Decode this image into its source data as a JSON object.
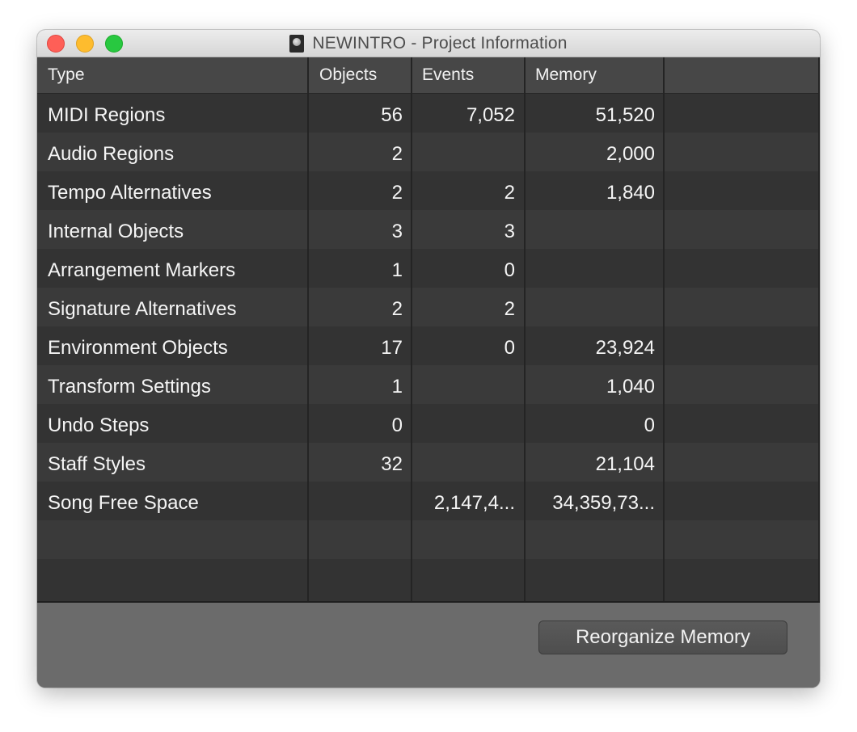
{
  "window": {
    "title": "NEWINTRO - Project Information",
    "icon": "logic-project-document-icon"
  },
  "table": {
    "columns": [
      "Type",
      "Objects",
      "Events",
      "Memory",
      ""
    ],
    "rows": [
      {
        "type": "MIDI Regions",
        "objects": "56",
        "events": "7,052",
        "memory": "51,520"
      },
      {
        "type": "Audio Regions",
        "objects": "2",
        "events": "",
        "memory": "2,000"
      },
      {
        "type": "Tempo Alternatives",
        "objects": "2",
        "events": "2",
        "memory": "1,840"
      },
      {
        "type": "Internal Objects",
        "objects": "3",
        "events": "3",
        "memory": ""
      },
      {
        "type": "Arrangement Markers",
        "objects": "1",
        "events": "0",
        "memory": ""
      },
      {
        "type": "Signature Alternatives",
        "objects": "2",
        "events": "2",
        "memory": ""
      },
      {
        "type": "Environment Objects",
        "objects": "17",
        "events": "0",
        "memory": "23,924"
      },
      {
        "type": "Transform Settings",
        "objects": "1",
        "events": "",
        "memory": "1,040"
      },
      {
        "type": "Undo Steps",
        "objects": "0",
        "events": "",
        "memory": "0"
      },
      {
        "type": "Staff Styles",
        "objects": "32",
        "events": "",
        "memory": "21,104"
      },
      {
        "type": "Song Free Space",
        "objects": "",
        "events": "2,147,4...",
        "memory": "34,359,73..."
      }
    ]
  },
  "footer": {
    "reorganize_label": "Reorganize Memory"
  },
  "colors": {
    "table_bg": "#333333",
    "row_alt": "#3a3a3a",
    "header_bg": "#474747",
    "footer_bg": "#6b6b6b",
    "close": "#fe5f57",
    "minimize": "#febc2e",
    "maximize": "#28c840"
  }
}
